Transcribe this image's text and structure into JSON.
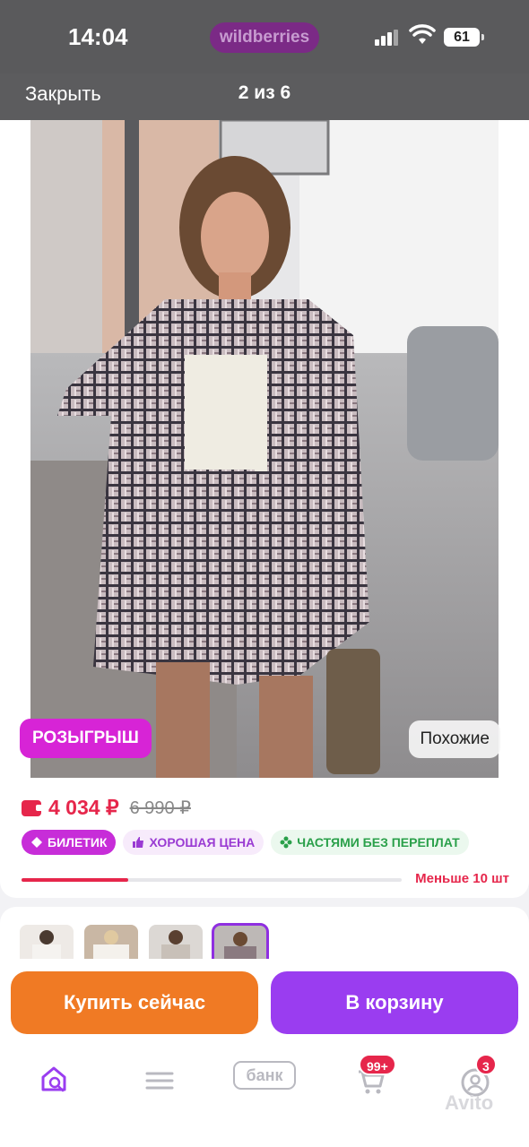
{
  "status_bar": {
    "time": "14:04",
    "brand": "wildberries",
    "battery": "61"
  },
  "viewer": {
    "close_label": "Закрыть",
    "counter": "2 из 6"
  },
  "photo": {
    "raffle_label": "РОЗЫГРЫШ",
    "similar_label": "Похожие"
  },
  "product": {
    "price_current": "4 034 ₽",
    "price_old": "6 990 ₽",
    "badges": [
      {
        "label": "БИЛЕТИК",
        "icon": "ticket-icon"
      },
      {
        "label": "ХОРОШАЯ ЦЕНА",
        "icon": "thumbs-up-icon"
      },
      {
        "label": "ЧАСТЯМИ БЕЗ ПЕРЕПЛАТ",
        "icon": "parts-icon"
      }
    ],
    "stock_level": 0.28,
    "stock_text": "Меньше 10 шт"
  },
  "actions": {
    "buy_now": "Купить сейчас",
    "add_to_cart": "В корзину"
  },
  "tab_bar": {
    "bank_label": "банк",
    "cart_count": "99+",
    "profile_count": "3"
  },
  "watermark": "Avito",
  "colors": {
    "accent_purple": "#9a3df0",
    "buy_orange": "#f07a24",
    "price_red": "#e6264b",
    "raffle_pink": "#d724d6"
  }
}
